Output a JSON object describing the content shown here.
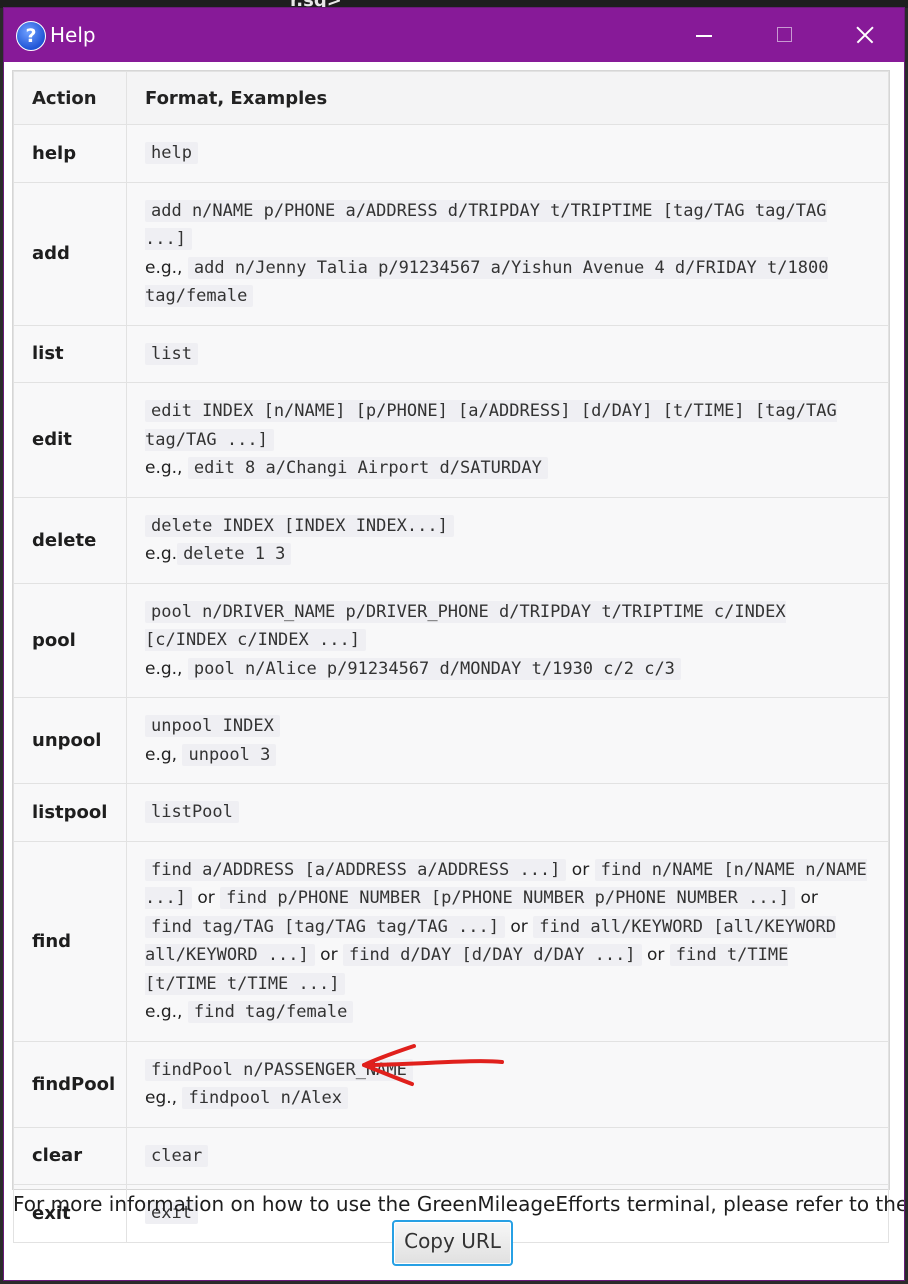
{
  "background": {
    "terminal_fragment": "r.sq>"
  },
  "window": {
    "title": "Help",
    "icon": "help-icon",
    "accent": "#871a98"
  },
  "table": {
    "headers": {
      "action": "Action",
      "format": "Format, Examples"
    },
    "rows": [
      {
        "action": "help",
        "lines": [
          [
            {
              "t": "code",
              "v": "help"
            }
          ]
        ]
      },
      {
        "action": "add",
        "lines": [
          [
            {
              "t": "code",
              "v": "add n/NAME p/PHONE a/ADDRESS d/TRIPDAY t/TRIPTIME [tag/TAG tag/TAG ...]"
            }
          ],
          [
            {
              "t": "text",
              "v": "e.g., "
            },
            {
              "t": "code",
              "v": "add n/Jenny Talia p/91234567 a/Yishun Avenue 4 d/FRIDAY t/1800 tag/female"
            }
          ]
        ]
      },
      {
        "action": "list",
        "lines": [
          [
            {
              "t": "code",
              "v": "list"
            }
          ]
        ]
      },
      {
        "action": "edit",
        "lines": [
          [
            {
              "t": "code",
              "v": "edit INDEX [n/NAME] [p/PHONE] [a/ADDRESS] [d/DAY] [t/TIME] [tag/TAG tag/TAG ...]"
            }
          ],
          [
            {
              "t": "text",
              "v": "e.g., "
            },
            {
              "t": "code",
              "v": "edit 8 a/Changi Airport d/SATURDAY"
            }
          ]
        ]
      },
      {
        "action": "delete",
        "lines": [
          [
            {
              "t": "code",
              "v": "delete INDEX [INDEX INDEX...]"
            }
          ],
          [
            {
              "t": "text",
              "v": "e.g."
            },
            {
              "t": "code",
              "v": "delete 1 3"
            }
          ]
        ]
      },
      {
        "action": "pool",
        "lines": [
          [
            {
              "t": "code",
              "v": "pool n/DRIVER_NAME p/DRIVER_PHONE d/TRIPDAY t/TRIPTIME c/INDEX [c/INDEX c/INDEX ...]"
            }
          ],
          [
            {
              "t": "text",
              "v": "e.g., "
            },
            {
              "t": "code",
              "v": "pool n/Alice p/91234567 d/MONDAY t/1930 c/2 c/3"
            }
          ]
        ]
      },
      {
        "action": "unpool",
        "lines": [
          [
            {
              "t": "code",
              "v": "unpool INDEX"
            }
          ],
          [
            {
              "t": "text",
              "v": "e.g, "
            },
            {
              "t": "code",
              "v": "unpool 3"
            }
          ]
        ]
      },
      {
        "action": "listpool",
        "lines": [
          [
            {
              "t": "code",
              "v": "listPool"
            }
          ]
        ]
      },
      {
        "action": "find",
        "lines": [
          [
            {
              "t": "code",
              "v": "find a/ADDRESS [a/ADDRESS a/ADDRESS ...]"
            },
            {
              "t": "text",
              "v": " or "
            },
            {
              "t": "code",
              "v": "find n/NAME [n/NAME n/NAME ...]"
            },
            {
              "t": "text",
              "v": " or "
            },
            {
              "t": "code",
              "v": "find p/PHONE NUMBER [p/PHONE NUMBER p/PHONE NUMBER ...]"
            },
            {
              "t": "text",
              "v": " or "
            },
            {
              "t": "code",
              "v": "find tag/TAG [tag/TAG tag/TAG ...]"
            },
            {
              "t": "text",
              "v": " or "
            },
            {
              "t": "code",
              "v": "find all/KEYWORD [all/KEYWORD all/KEYWORD ...]"
            },
            {
              "t": "text",
              "v": " or "
            },
            {
              "t": "code",
              "v": "find d/DAY [d/DAY d/DAY ...]"
            },
            {
              "t": "text",
              "v": " or "
            },
            {
              "t": "code",
              "v": "find t/TIME [t/TIME t/TIME ...]"
            }
          ],
          [
            {
              "t": "text",
              "v": "e.g., "
            },
            {
              "t": "code",
              "v": "find tag/female"
            }
          ]
        ]
      },
      {
        "action": "findPool",
        "lines": [
          [
            {
              "t": "code",
              "v": "findPool n/PASSENGER_NAME"
            }
          ],
          [
            {
              "t": "text",
              "v": "eg., "
            },
            {
              "t": "code",
              "v": "findpool n/Alex"
            }
          ]
        ]
      },
      {
        "action": "clear",
        "lines": [
          [
            {
              "t": "code",
              "v": "clear"
            }
          ]
        ]
      },
      {
        "action": "exit",
        "lines": [
          [
            {
              "t": "code",
              "v": "exit"
            }
          ]
        ]
      }
    ]
  },
  "footer": {
    "text": "For more information on how to use the GreenMileageEfforts terminal, please refer to the use",
    "copy_button": "Copy URL"
  },
  "annotation": {
    "icon": "red-arrow-icon",
    "color": "#e0201c"
  }
}
